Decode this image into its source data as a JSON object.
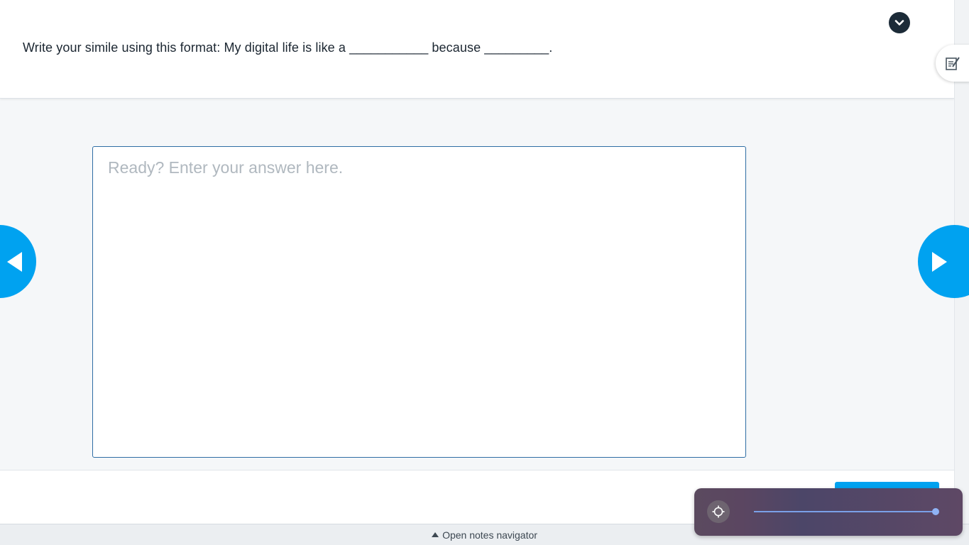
{
  "prompt": {
    "text": "Write your simile using this format: My digital life is like a ___________ because _________."
  },
  "answer": {
    "placeholder": "Ready? Enter your answer here.",
    "value": ""
  },
  "footer": {
    "notes_navigator_label": "Open notes navigator"
  },
  "overlay": {
    "slider_level": 1.0
  },
  "colors": {
    "accent": "#00a2f0",
    "dark": "#1c2b38",
    "input_border": "#2e6da4"
  },
  "icons": {
    "collapse": "chevron-down-icon",
    "notes": "note-edit-icon",
    "prev": "triangle-left-icon",
    "next": "triangle-right-icon",
    "overlay": "gear-icon"
  }
}
